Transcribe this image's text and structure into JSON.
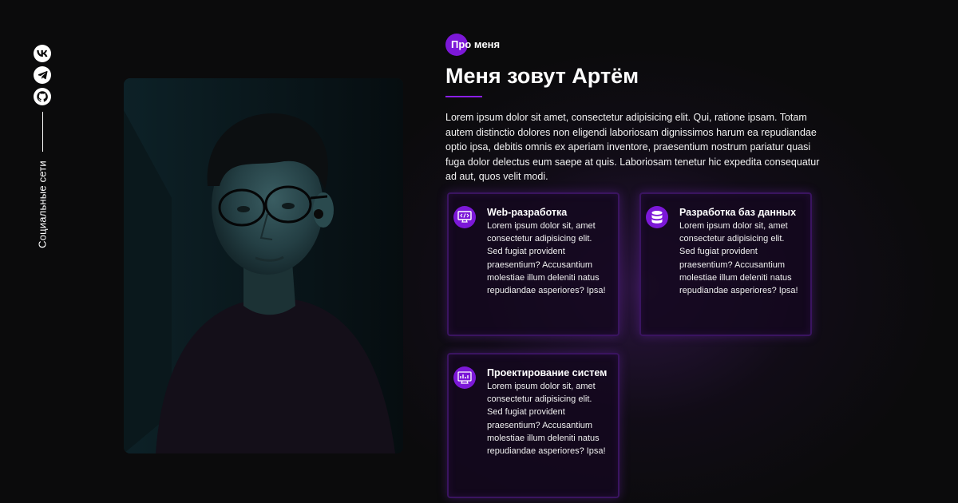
{
  "socials": {
    "items": [
      {
        "name": "vk",
        "icon": "vk-icon"
      },
      {
        "name": "telegram",
        "icon": "telegram-icon"
      },
      {
        "name": "github",
        "icon": "github-icon"
      }
    ],
    "label": "Социальные сети"
  },
  "about": {
    "badge": "Про меня",
    "title": "Меня зовут Артём",
    "description": "Lorem ipsum dolor sit amet, consectetur adipisicing elit. Qui, ratione ipsam. Totam autem distinctio dolores non eligendi laboriosam dignissimos harum ea repudiandae optio ipsa, debitis omnis ex aperiam inventore, praesentium nostrum pariatur quasi fuga dolor delectus eum saepe at quis. Laboriosam tenetur hic expedita consequatur ad aut, quos velit modi."
  },
  "services": [
    {
      "icon": "code-monitor-icon",
      "title": "Web-разработка",
      "text": "Lorem ipsum dolor sit, amet consectetur adipisicing elit. Sed fugiat provident praesentium? Accusantium molestiae illum deleniti natus repudiandae asperiores? Ipsa!"
    },
    {
      "icon": "database-icon",
      "title": "Разработка баз данных",
      "text": "Lorem ipsum dolor sit, amet consectetur adipisicing elit. Sed fugiat provident praesentium? Accusantium molestiae illum deleniti natus repudiandae asperiores? Ipsa!"
    },
    {
      "icon": "system-design-icon",
      "title": "Проектирование систем",
      "text": "Lorem ipsum dolor sit, amet consectetur adipisicing elit. Sed fugiat provident praesentium? Accusantium molestiae illum deleniti natus repudiandae asperiores? Ipsa!"
    }
  ],
  "colors": {
    "accent": "#7c18d8",
    "background": "#0b0b0c",
    "card_border": "#3a1460"
  }
}
